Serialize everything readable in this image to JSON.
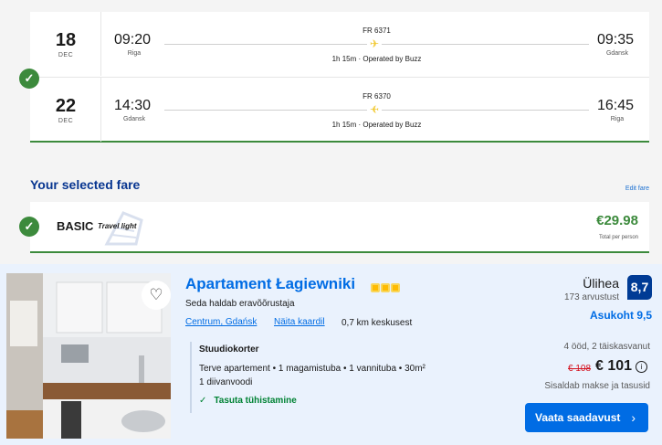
{
  "flights": {
    "legs": [
      {
        "day": "18",
        "month": "DEC",
        "dep_time": "09:20",
        "dep_city": "Riga",
        "arr_time": "09:35",
        "arr_city": "Gdansk",
        "flight_no": "FR 6371",
        "duration": "1h 15m · Operated by Buzz"
      },
      {
        "day": "22",
        "month": "DEC",
        "dep_time": "14:30",
        "dep_city": "Gdansk",
        "arr_time": "16:45",
        "arr_city": "Riga",
        "flight_no": "FR 6370",
        "duration": "1h 15m · Operated by Buzz"
      }
    ],
    "check_icon": "✓"
  },
  "fare": {
    "title": "Your selected fare",
    "edit_label": "Edit fare",
    "name": "BASIC",
    "subtitle": "Travel light",
    "price": "€29.98",
    "per_person": "Total per person",
    "check_icon": "✓"
  },
  "hotel": {
    "name": "Apartament Łagiewniki",
    "stars": 3,
    "managed_by": "Seda haldab eravõõrustaja",
    "location_link": "Centrum, Gdańsk",
    "map_link": "Näita kaardil",
    "distance": "0,7 km keskusest",
    "room_name": "Stuudiokorter",
    "room_desc": "Terve apartement • 1 magamistuba • 1 vannituba • 30m²",
    "room_beds": "1 diivanvoodi",
    "cancel_icon": "✓",
    "cancel_text": "Tasuta tühistamine",
    "score_word": "Ülihea",
    "reviews": "173 arvustust",
    "score": "8,7",
    "location_score": "Asukoht 9,5",
    "nights": "4 ööd, 2 täiskasvanut",
    "old_price": "€ 108",
    "new_price": "€ 101",
    "info_icon": "i",
    "taxes": "Sisaldab makse ja tasusid",
    "cta_label": "Vaata saadavust",
    "cta_chevron": "›",
    "fav_icon": "♡"
  },
  "colors": {
    "green": "#3c8a3c",
    "navy": "#073590",
    "blue": "#006ce4",
    "score_bg": "#003b95",
    "plane_yellow": "#f1c933"
  }
}
